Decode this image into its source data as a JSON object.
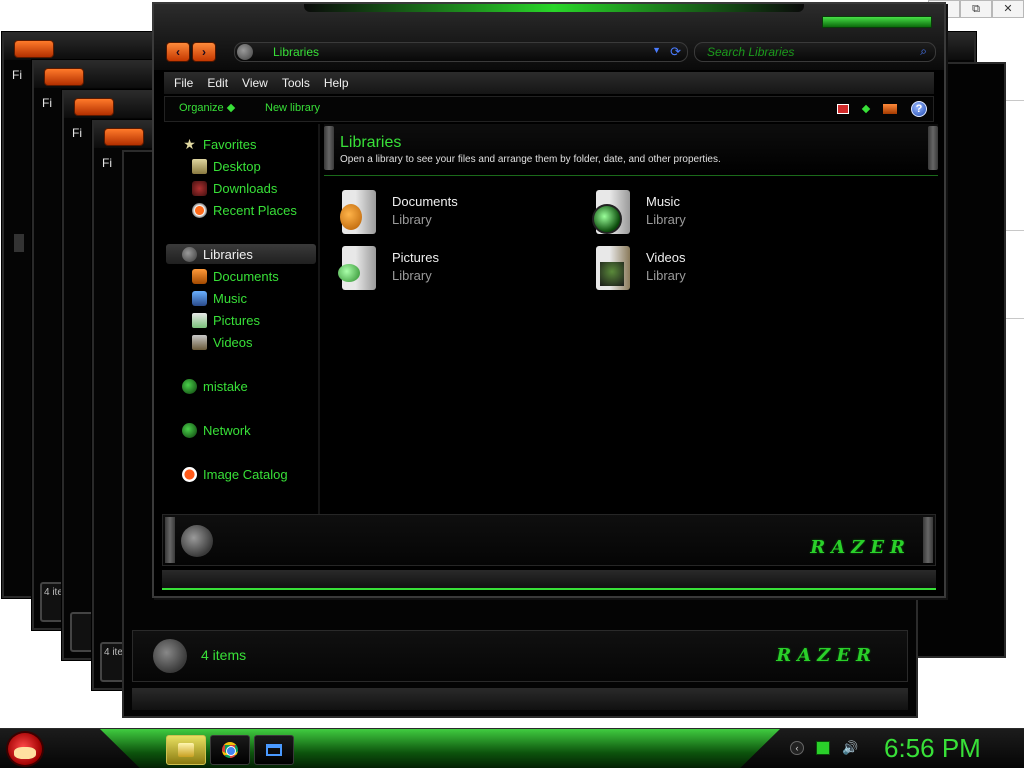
{
  "browser_controls": {
    "restore_glyph": "⧉",
    "close_glyph": "✕"
  },
  "address_bar": {
    "location": "Libraries",
    "search_placeholder": "Search Libraries"
  },
  "menu": [
    "File",
    "Edit",
    "View",
    "Tools",
    "Help"
  ],
  "background_menu_text": "Fi",
  "command_bar": {
    "organize": "Organize",
    "new_library": "New library",
    "help_glyph": "?"
  },
  "nav_buttons": {
    "back": "‹",
    "forward": "›"
  },
  "nav_pane": {
    "favorites": {
      "label": "Favorites",
      "items": [
        "Desktop",
        "Downloads",
        "Recent Places"
      ]
    },
    "libraries": {
      "label": "Libraries",
      "items": [
        "Documents",
        "Music",
        "Pictures",
        "Videos"
      ]
    },
    "other": [
      "mistake",
      "Network",
      "Image Catalog"
    ]
  },
  "content": {
    "title": "Libraries",
    "subtitle": "Open a library to see your files and arrange them by folder, date, and other properties.",
    "libraries": [
      {
        "name": "Documents",
        "type": "Library",
        "icon": "documents-library-icon"
      },
      {
        "name": "Music",
        "type": "Library",
        "icon": "music-library-icon"
      },
      {
        "name": "Pictures",
        "type": "Library",
        "icon": "pictures-library-icon"
      },
      {
        "name": "Videos",
        "type": "Library",
        "icon": "videos-library-icon"
      }
    ]
  },
  "footer": {
    "brand": "RAZER"
  },
  "status": {
    "item_count": "4 items",
    "item_count_short": "4 ite"
  },
  "taskbar": {
    "clock": "6:56 PM"
  },
  "colors": {
    "accent_green": "#38e038",
    "window_bg": "#000000",
    "nav_orange": "#e45a10"
  }
}
